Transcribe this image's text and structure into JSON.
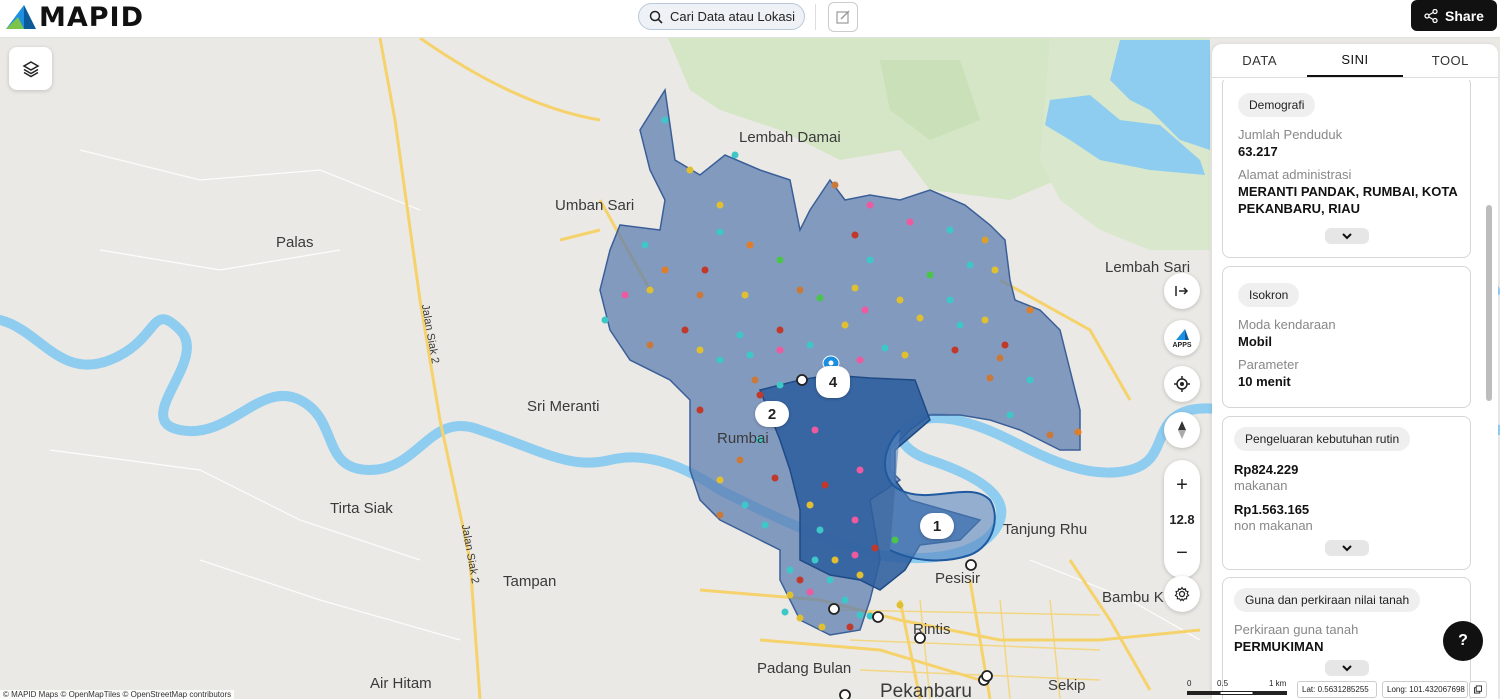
{
  "app": {
    "brand": "MAPID"
  },
  "header": {
    "search_label": "Cari Data atau Lokasi",
    "share_label": "Share"
  },
  "map": {
    "labels": [
      {
        "id": "lembah-damai",
        "text": "Lembah Damai"
      },
      {
        "id": "umban-sari",
        "text": "Umban Sari"
      },
      {
        "id": "palas",
        "text": "Palas"
      },
      {
        "id": "lembah-sari",
        "text": "Lembah Sari"
      },
      {
        "id": "sri-meranti",
        "text": "Sri Meranti"
      },
      {
        "id": "rumbai",
        "text": "Rumbai"
      },
      {
        "id": "tirta-siak",
        "text": "Tirta Siak"
      },
      {
        "id": "tanjung-rhu",
        "text": "Tanjung Rhu"
      },
      {
        "id": "pesisir",
        "text": "Pesisir"
      },
      {
        "id": "tampan",
        "text": "Tampan"
      },
      {
        "id": "bambu-kuning",
        "text": "Bambu K"
      },
      {
        "id": "rintis",
        "text": "Rintis"
      },
      {
        "id": "padang-bulan",
        "text": "Padang Bulan"
      },
      {
        "id": "air-hitam",
        "text": "Air Hitam"
      },
      {
        "id": "pekanbaru",
        "text": "Pekanbaru"
      },
      {
        "id": "sekip",
        "text": "Sekip"
      },
      {
        "id": "jalan-siak-2-a",
        "text": "Jalan Siak 2"
      },
      {
        "id": "jalan-siak-2-b",
        "text": "Jalan Siak 2"
      }
    ],
    "markers": [
      "1",
      "2",
      "4"
    ],
    "zoom_level": "12.8",
    "apps_label": "APPS",
    "scale": {
      "zero": "0",
      "half": "0.5",
      "one": "1 km"
    },
    "latitude": "Lat: 0.5631285255",
    "longitude": "Long: 101.432067698",
    "attribution": "© MAPID Maps © OpenMapTiles © OpenStreetMap contributors"
  },
  "panel": {
    "tabs": [
      {
        "label": "DATA",
        "active": false
      },
      {
        "label": "SINI",
        "active": true
      },
      {
        "label": "TOOL",
        "active": false
      }
    ],
    "demografi": {
      "title": "Demografi",
      "pop_label": "Jumlah Penduduk",
      "pop_value": "63.217",
      "addr_label": "Alamat administrasi",
      "addr_value": "MERANTI PANDAK, RUMBAI, KOTA PEKANBARU, RIAU"
    },
    "isokron": {
      "title": "Isokron",
      "mode_label": "Moda kendaraan",
      "mode_value": "Mobil",
      "param_label": "Parameter",
      "param_value": "10 menit"
    },
    "pengeluaran": {
      "title": "Pengeluaran kebutuhan rutin",
      "food_value": "Rp824.229",
      "food_label": "makanan",
      "nonfood_value": "Rp1.563.165",
      "nonfood_label": "non makanan"
    },
    "tanah": {
      "title": "Guna dan perkiraan nilai tanah",
      "use_label": "Perkiraan guna tanah",
      "use_value": "PERMUKIMAN"
    }
  },
  "help_label": "?",
  "colors": {
    "water": "#8ecdf0",
    "isochrone_fill": "#5a7bb0",
    "isochrone_inner": "#2d5f9e",
    "accent_dark": "#111111"
  }
}
